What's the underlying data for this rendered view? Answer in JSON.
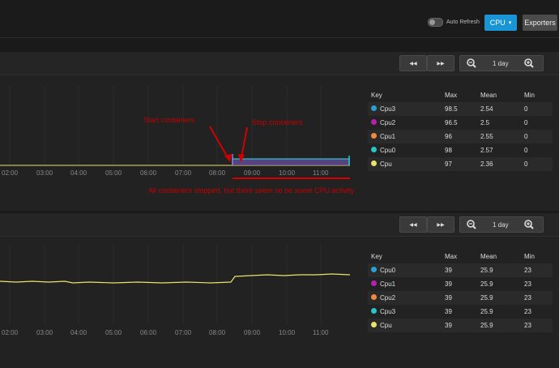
{
  "header": {
    "auto_refresh_label": "Auto Refresh",
    "cpu_button_label": "CPU",
    "cpu_caret": "▾",
    "exporters_label": "Exporters"
  },
  "colors": {
    "accent": "#1994d4",
    "cpu3": "#2a9fd6",
    "cpu2": "#b620b0",
    "cpu1": "#f08a3c",
    "cpu0": "#26c6c9",
    "cpu": "#e8e36a",
    "annotation": "#c40000"
  },
  "panels": [
    {
      "controls": {
        "rewind": "◀◀",
        "forward": "▶▶",
        "zoom_out": "🔍",
        "range": "1 day",
        "zoom_in": "🔍"
      },
      "x_ticks": [
        "02:00",
        "03:00",
        "04:00",
        "05:00",
        "06:00",
        "07:00",
        "08:00",
        "09:00",
        "10:00",
        "11:00"
      ],
      "annotations": {
        "start": "Start containers",
        "stop": "Stop containers",
        "note": "All containers stopped, but there seem so be some CPU activity"
      },
      "table": {
        "headers": {
          "key": "Key",
          "max": "Max",
          "mean": "Mean",
          "min": "Min"
        },
        "rows": [
          {
            "key": "Cpu3",
            "color": "#2a9fd6",
            "max": "98.5",
            "mean": "2.54",
            "min": "0"
          },
          {
            "key": "Cpu2",
            "color": "#b620b0",
            "max": "96.5",
            "mean": "2.5",
            "min": "0"
          },
          {
            "key": "Cpu1",
            "color": "#f08a3c",
            "max": "96",
            "mean": "2.55",
            "min": "0"
          },
          {
            "key": "Cpu0",
            "color": "#26c6c9",
            "max": "98",
            "mean": "2.57",
            "min": "0"
          },
          {
            "key": "Cpu",
            "color": "#e8e36a",
            "max": "97",
            "mean": "2.36",
            "min": "0"
          }
        ]
      }
    },
    {
      "controls": {
        "rewind": "◀◀",
        "forward": "▶▶",
        "zoom_out": "🔍",
        "range": "1 day",
        "zoom_in": "🔍"
      },
      "x_ticks": [
        "02:00",
        "03:00",
        "04:00",
        "05:00",
        "06:00",
        "07:00",
        "08:00",
        "09:00",
        "10:00",
        "11:00"
      ],
      "table": {
        "headers": {
          "key": "Key",
          "max": "Max",
          "mean": "Mean",
          "min": "Min"
        },
        "rows": [
          {
            "key": "Cpu0",
            "color": "#2a9fd6",
            "max": "39",
            "mean": "25.9",
            "min": "23"
          },
          {
            "key": "Cpu1",
            "color": "#b620b0",
            "max": "39",
            "mean": "25.9",
            "min": "23"
          },
          {
            "key": "Cpu2",
            "color": "#f08a3c",
            "max": "39",
            "mean": "25.9",
            "min": "23"
          },
          {
            "key": "Cpu3",
            "color": "#26c6c9",
            "max": "39",
            "mean": "25.9",
            "min": "23"
          },
          {
            "key": "Cpu",
            "color": "#e8e36a",
            "max": "39",
            "mean": "25.9",
            "min": "23"
          }
        ]
      }
    }
  ]
}
